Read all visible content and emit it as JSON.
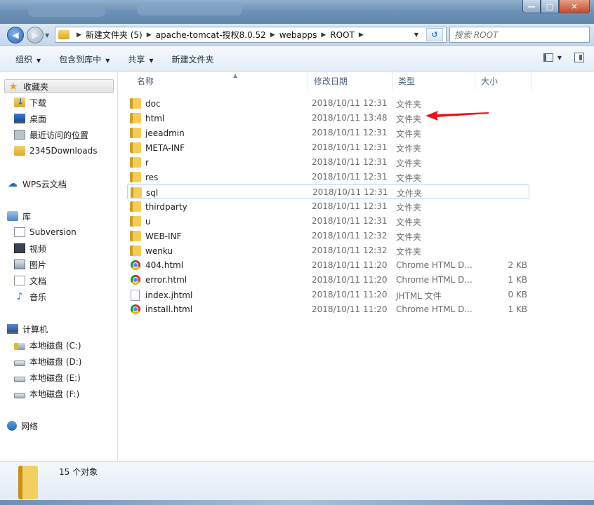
{
  "window": {
    "minimize_glyph": "—",
    "maximize_glyph": "□"
  },
  "address": {
    "crumbs": [
      "新建文件夹 (5)",
      "apache-tomcat-授权8.0.52",
      "webapps",
      "ROOT"
    ],
    "search_placeholder": "搜索 ROOT"
  },
  "toolbar": {
    "organize": "组织",
    "include_library": "包含到库中",
    "share": "共享",
    "new_folder": "新建文件夹"
  },
  "nav": {
    "favorites": "收藏夹",
    "downloads": "下载",
    "desktop": "桌面",
    "recent": "最近访问的位置",
    "downloads2345": "2345Downloads",
    "wps": "WPS云文档",
    "libraries": "库",
    "subversion": "Subversion",
    "videos": "视频",
    "pictures": "图片",
    "documents": "文档",
    "music": "音乐",
    "computer": "计算机",
    "drive_c": "本地磁盘 (C:)",
    "drive_d": "本地磁盘 (D:)",
    "drive_e": "本地磁盘 (E:)",
    "drive_f": "本地磁盘 (F:)",
    "network": "网络"
  },
  "columns": {
    "name": "名称",
    "date": "修改日期",
    "type": "类型",
    "size": "大小"
  },
  "files": [
    {
      "name": "doc",
      "date": "2018/10/11 12:31",
      "type": "文件夹",
      "size": "",
      "icon": "folder-icon"
    },
    {
      "name": "html",
      "date": "2018/10/11 13:48",
      "type": "文件夹",
      "size": "",
      "icon": "folder-icon"
    },
    {
      "name": "jeeadmin",
      "date": "2018/10/11 12:31",
      "type": "文件夹",
      "size": "",
      "icon": "folder-icon"
    },
    {
      "name": "META-INF",
      "date": "2018/10/11 12:31",
      "type": "文件夹",
      "size": "",
      "icon": "folder-icon"
    },
    {
      "name": "r",
      "date": "2018/10/11 12:31",
      "type": "文件夹",
      "size": "",
      "icon": "folder-icon"
    },
    {
      "name": "res",
      "date": "2018/10/11 12:31",
      "type": "文件夹",
      "size": "",
      "icon": "folder-icon"
    },
    {
      "name": "sql",
      "date": "2018/10/11 12:31",
      "type": "文件夹",
      "size": "",
      "icon": "folder-icon"
    },
    {
      "name": "thirdparty",
      "date": "2018/10/11 12:31",
      "type": "文件夹",
      "size": "",
      "icon": "folder-icon"
    },
    {
      "name": "u",
      "date": "2018/10/11 12:31",
      "type": "文件夹",
      "size": "",
      "icon": "folder-icon"
    },
    {
      "name": "WEB-INF",
      "date": "2018/10/11 12:32",
      "type": "文件夹",
      "size": "",
      "icon": "folder-icon"
    },
    {
      "name": "wenku",
      "date": "2018/10/11 12:32",
      "type": "文件夹",
      "size": "",
      "icon": "folder-icon"
    },
    {
      "name": "404.html",
      "date": "2018/10/11 11:20",
      "type": "Chrome HTML D...",
      "size": "2 KB",
      "icon": "chrome-icon"
    },
    {
      "name": "error.html",
      "date": "2018/10/11 11:20",
      "type": "Chrome HTML D...",
      "size": "1 KB",
      "icon": "chrome-icon"
    },
    {
      "name": "index.jhtml",
      "date": "2018/10/11 11:20",
      "type": "JHTML 文件",
      "size": "0 KB",
      "icon": "blank-file-icon"
    },
    {
      "name": "install.html",
      "date": "2018/10/11 11:20",
      "type": "Chrome HTML D...",
      "size": "1 KB",
      "icon": "chrome-icon"
    }
  ],
  "status": {
    "count": "15 个对象"
  },
  "colors": {
    "annotation_arrow": "#e8141c",
    "selection_border": "#b9d4ee"
  }
}
